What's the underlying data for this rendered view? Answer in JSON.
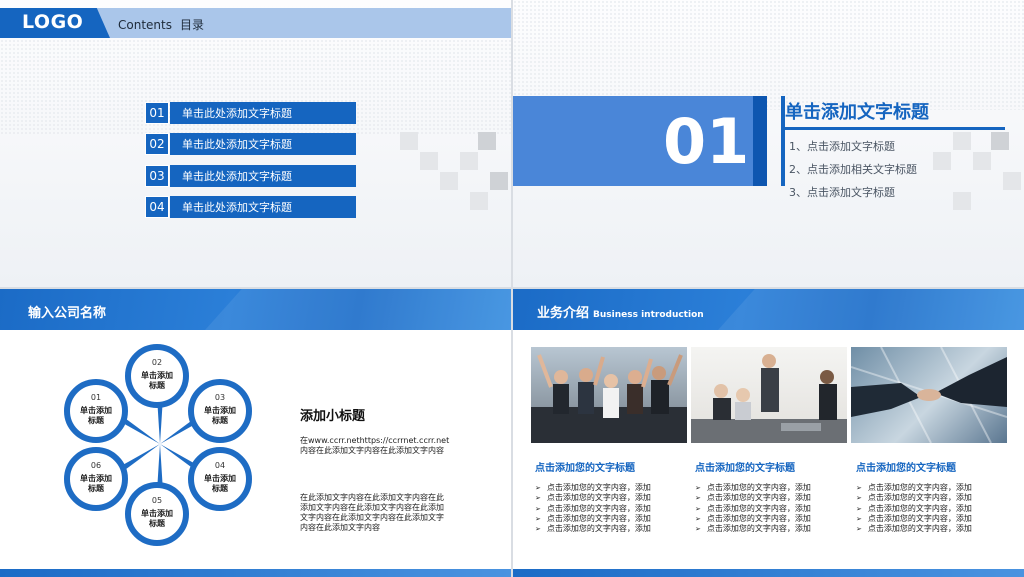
{
  "slide1": {
    "logo": "LOGO",
    "contents_en": "Contents",
    "contents_zh": "目录",
    "toc": [
      {
        "num": "01",
        "label": "单击此处添加文字标题"
      },
      {
        "num": "02",
        "label": "单击此处添加文字标题"
      },
      {
        "num": "03",
        "label": "单击此处添加文字标题"
      },
      {
        "num": "04",
        "label": "单击此处添加文字标题"
      }
    ]
  },
  "slide2": {
    "number": "01",
    "title": "单击添加文字标题",
    "items": [
      "1、点击添加文字标题",
      "2、点击添加相关文字标题",
      "3、点击添加文字标题"
    ]
  },
  "slide3": {
    "banner": "输入公司名称",
    "petals": [
      {
        "num": "01",
        "label": "单击添加标题"
      },
      {
        "num": "02",
        "label": "单击添加标题"
      },
      {
        "num": "03",
        "label": "单击添加标题"
      },
      {
        "num": "04",
        "label": "单击添加标题"
      },
      {
        "num": "05",
        "label": "单击添加标题"
      },
      {
        "num": "06",
        "label": "单击添加标题"
      }
    ],
    "subtitle": "添加小标题",
    "para1": "在www.ccrr.nethttps://ccrrnet.ccrr.net内容在此添加文字内容在此添加文字内容",
    "para2": "在此添加文字内容在此添加文字内容在此添加文字内容在此添加文字内容在此添加文字内容在此添加文字内容在此添加文字内容在此添加文字内容"
  },
  "slide4": {
    "banner": "业务介绍",
    "banner_sub": "Business introduction",
    "columns": [
      {
        "title": "点击添加您的文字标题",
        "bullets": [
          "点击添加您的文字内容，添加",
          "点击添加您的文字内容，添加",
          "点击添加您的文字内容，添加",
          "点击添加您的文字内容，添加",
          "点击添加您的文字内容，添加"
        ]
      },
      {
        "title": "点击添加您的文字标题",
        "bullets": [
          "点击添加您的文字内容，添加",
          "点击添加您的文字内容，添加",
          "点击添加您的文字内容，添加",
          "点击添加您的文字内容，添加",
          "点击添加您的文字内容，添加"
        ]
      },
      {
        "title": "点击添加您的文字标题",
        "bullets": [
          "点击添加您的文字内容，添加",
          "点击添加您的文字内容，添加",
          "点击添加您的文字内容，添加",
          "点击添加您的文字内容，添加",
          "点击添加您的文字内容，添加"
        ]
      }
    ]
  }
}
